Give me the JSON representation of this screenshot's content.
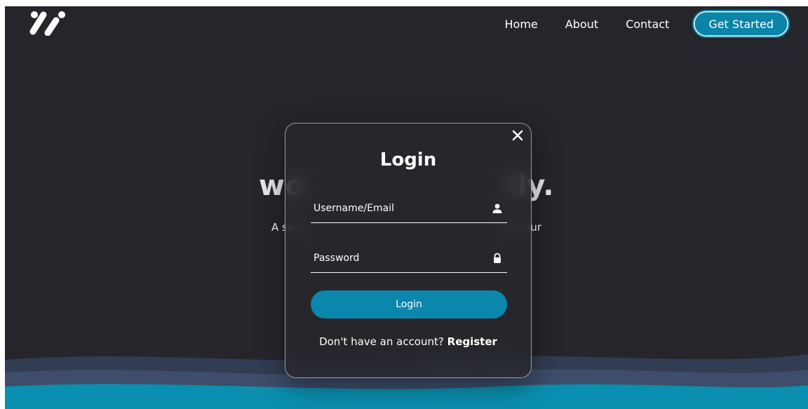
{
  "nav": {
    "links": [
      "Home",
      "About",
      "Contact"
    ],
    "cta_label": "Get Started"
  },
  "hero": {
    "title_visible": "wo                    lly.",
    "subtitle_visible": "A simp                                                          ge your"
  },
  "login_modal": {
    "title": "Login",
    "username_placeholder": "Username/Email",
    "password_placeholder": "Password",
    "submit_label": "Login",
    "register_prompt": "Don't have an account?",
    "register_link": "Register",
    "icons": [
      "close-icon",
      "user-icon",
      "lock-icon"
    ]
  },
  "colors": {
    "background": "#25262b",
    "accent": "#0b86ad",
    "wave_dark": "#39475f",
    "wave_teal": "#0a8fb0"
  }
}
